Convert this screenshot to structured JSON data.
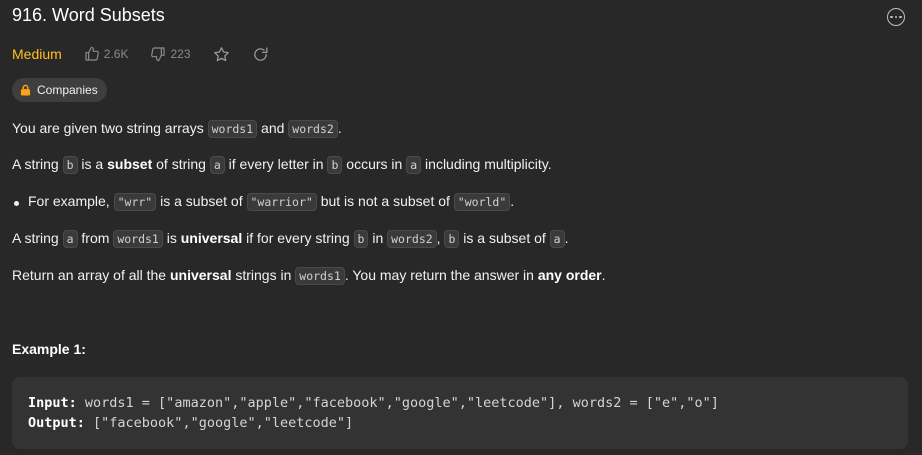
{
  "problem": {
    "title": "916. Word Subsets",
    "difficulty": "Medium",
    "likes": "2.6K",
    "dislikes": "223",
    "companies_label": "Companies"
  },
  "description": {
    "p1": {
      "t1": "You are given two string arrays ",
      "c1": "words1",
      "t2": " and ",
      "c2": "words2",
      "t3": "."
    },
    "p2": {
      "t1": "A string ",
      "c1": "b",
      "t2": " is a ",
      "b1": "subset",
      "t3": " of string ",
      "c2": "a",
      "t4": " if every letter in ",
      "c3": "b",
      "t5": " occurs in ",
      "c4": "a",
      "t6": " including multiplicity."
    },
    "bullet": {
      "t1": "For example, ",
      "c1": "\"wrr\"",
      "t2": " is a subset of ",
      "c2": "\"warrior\"",
      "t3": " but is not a subset of ",
      "c3": "\"world\"",
      "t4": "."
    },
    "p3": {
      "t1": "A string ",
      "c1": "a",
      "t2": " from ",
      "c2": "words1",
      "t3": " is ",
      "b1": "universal",
      "t4": " if for every string ",
      "c3": "b",
      "t5": " in ",
      "c4": "words2",
      "t6": ", ",
      "c5": "b",
      "t7": " is a subset of ",
      "c6": "a",
      "t8": "."
    },
    "p4": {
      "t1": "Return an array of all the ",
      "b1": "universal",
      "t2": " strings in ",
      "c1": "words1",
      "t3": ". You may return the answer in ",
      "b2": "any order",
      "t4": "."
    }
  },
  "example": {
    "heading": "Example 1:",
    "input_label": "Input:",
    "input_value": " words1 = [\"amazon\",\"apple\",\"facebook\",\"google\",\"leetcode\"], words2 = [\"e\",\"o\"]",
    "output_label": "Output:",
    "output_value": " [\"facebook\",\"google\",\"leetcode\"]"
  },
  "colors": {
    "background": "#282828",
    "difficulty_medium": "#ffc01e",
    "text": "#eff1f6",
    "muted": "#8a8a8a",
    "code_bg": "#3a3a3a",
    "example_bg": "#333333",
    "lock": "#ffa116"
  },
  "icons": [
    "thumbs-up-icon",
    "thumbs-down-icon",
    "star-icon",
    "share-icon",
    "lock-icon",
    "more-icon"
  ]
}
